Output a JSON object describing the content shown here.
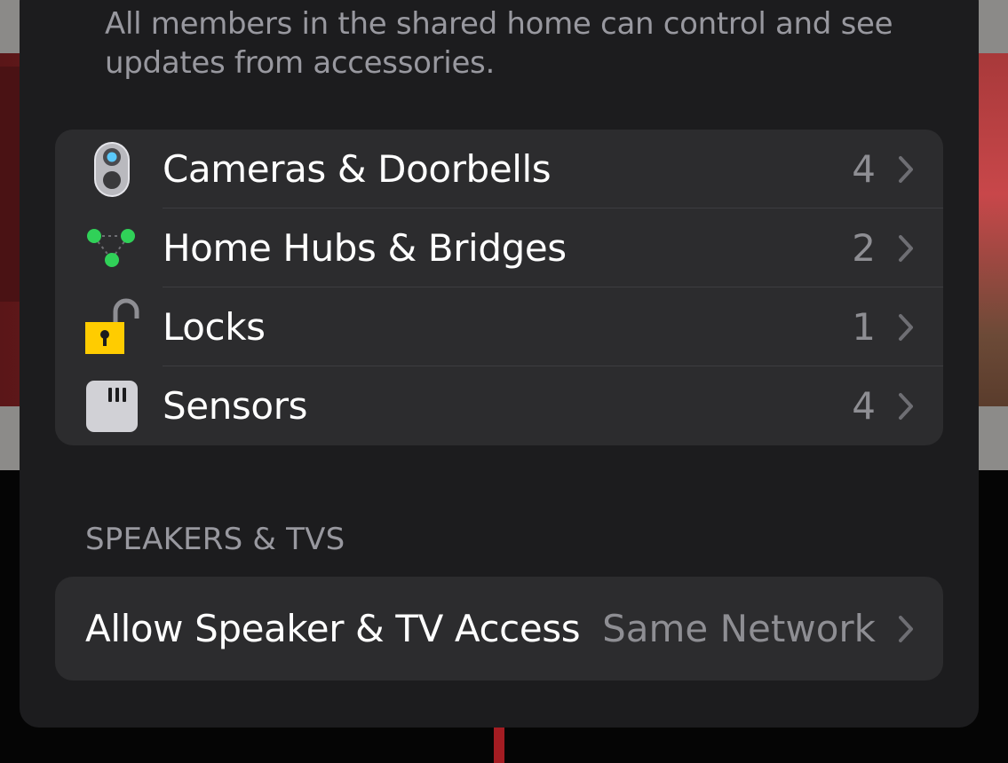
{
  "description": "All members in the shared home can control and see updates from accessories.",
  "accessories": [
    {
      "label": "Cameras & Doorbells",
      "count": "4",
      "icon": "camera-doorbell-icon"
    },
    {
      "label": "Home Hubs & Bridges",
      "count": "2",
      "icon": "hub-icon"
    },
    {
      "label": "Locks",
      "count": "1",
      "icon": "lock-icon"
    },
    {
      "label": "Sensors",
      "count": "4",
      "icon": "sensor-icon"
    }
  ],
  "speakers_section": {
    "header": "SPEAKERS & TVS",
    "row_label": "Allow Speaker & TV Access",
    "row_value": "Same Network"
  },
  "colors": {
    "sheet_bg": "#1c1c1e",
    "group_bg": "#2c2c2e",
    "primary_text": "#ffffff",
    "secondary_text": "#8e8e93",
    "hub_green": "#30d158",
    "lock_yellow": "#ffcc00",
    "camera_blue": "#5ac8fa"
  }
}
